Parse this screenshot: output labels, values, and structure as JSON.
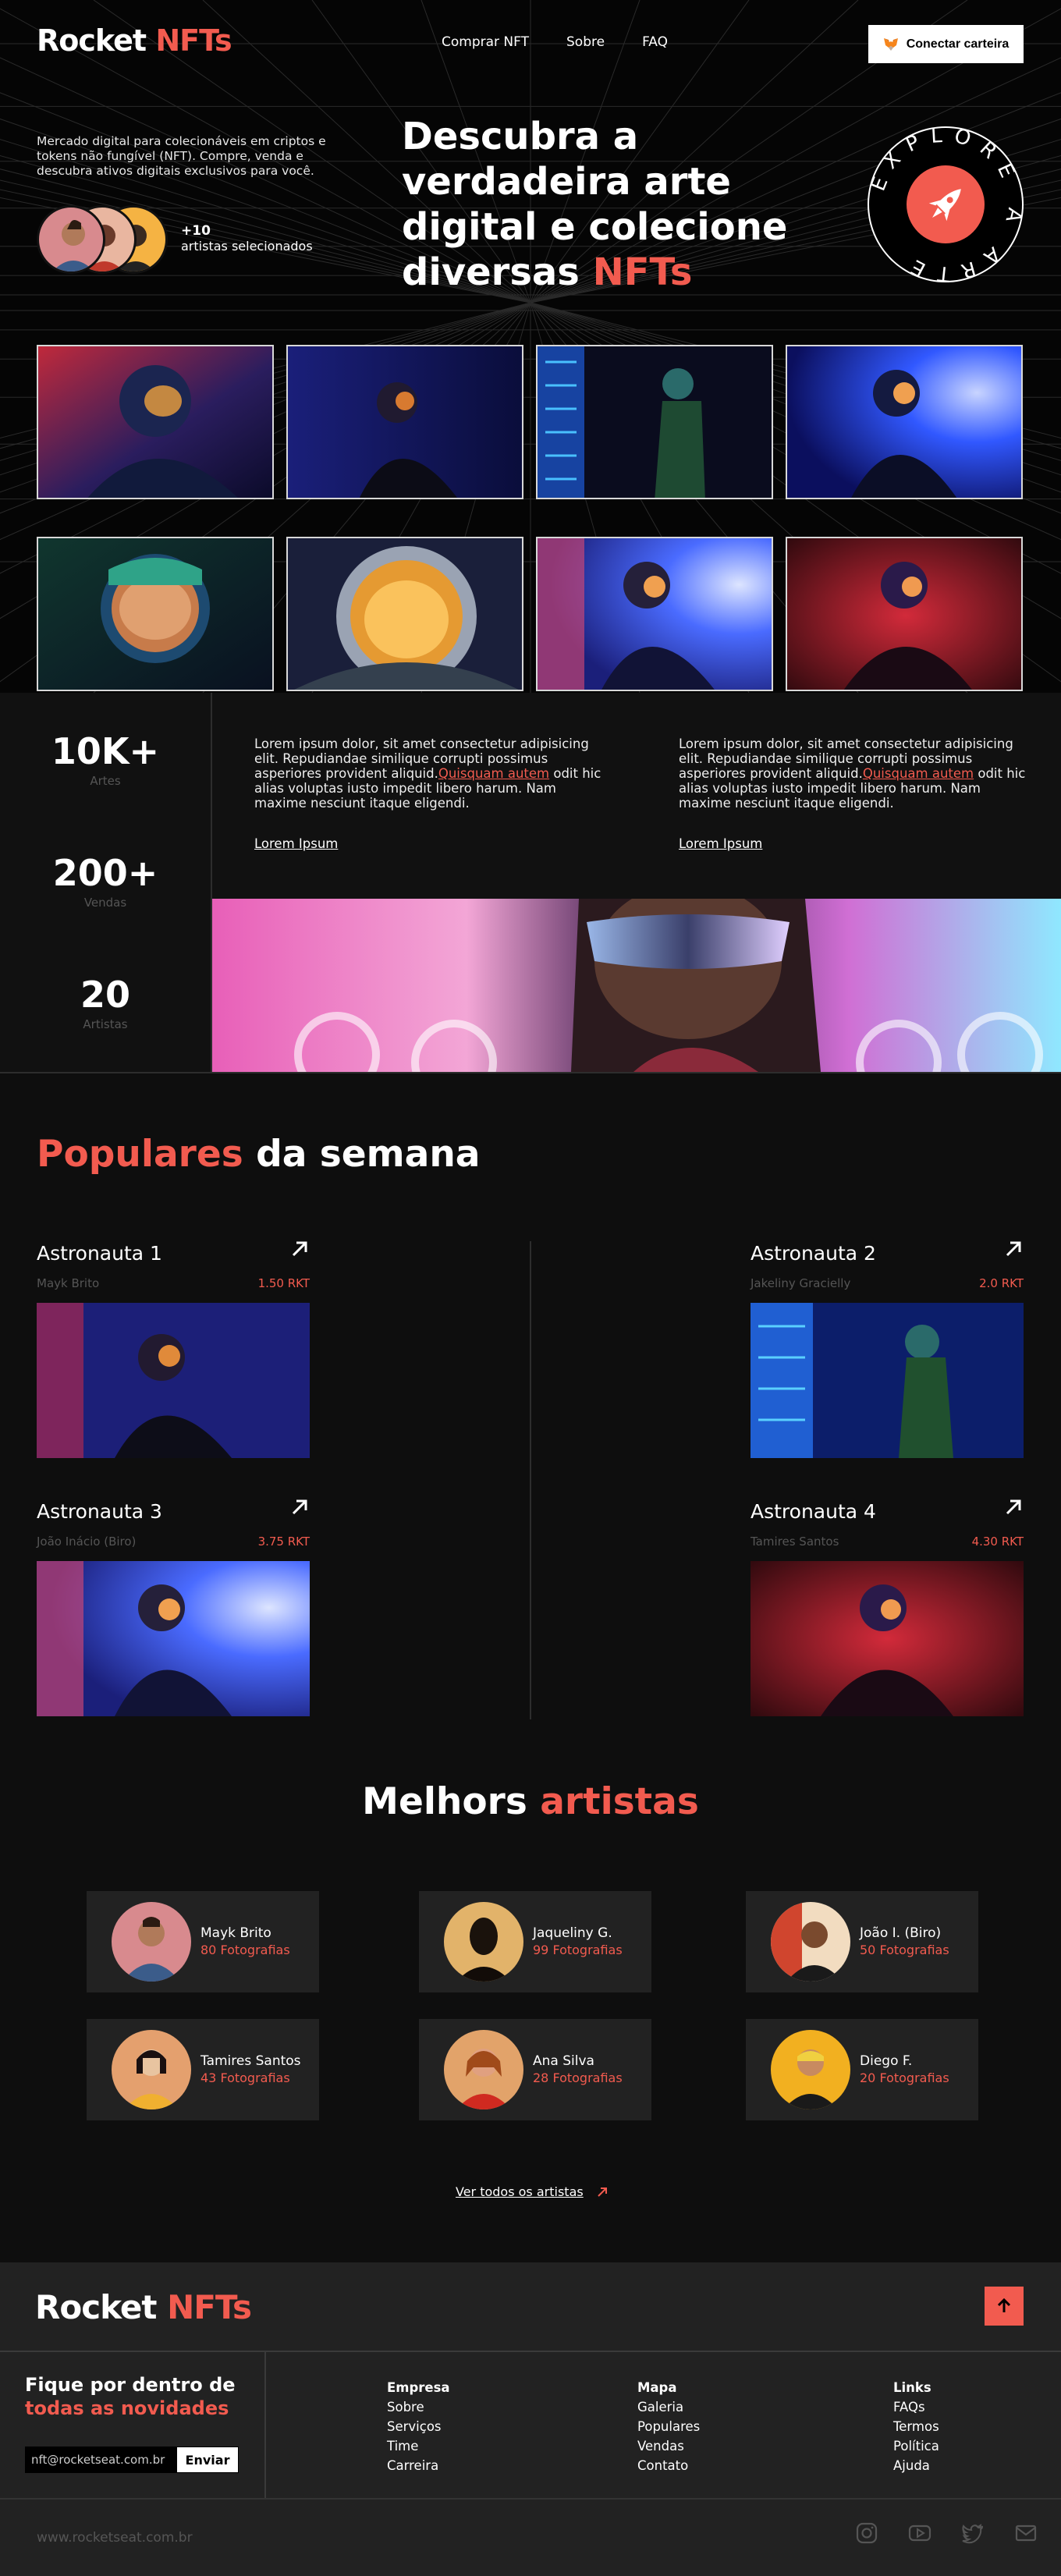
{
  "header": {
    "logo_main": "Rocket",
    "logo_accent": "NFTs",
    "nav": [
      "Comprar NFT",
      "Sobre",
      "FAQ"
    ],
    "wallet_button": "Conectar carteira"
  },
  "hero": {
    "description": "Mercado digital para colecionáveis em criptos e tokens não fungível (NFT). Compre, venda e descubra ativos digitais exclusivos para você.",
    "artists_count": "+10",
    "artists_label": "artistas selecionados",
    "headline_main": "Descubra a verdadeira arte digital e colecione diversas",
    "headline_accent": "NFTs",
    "badge_text": "EXPLORE A ARTE"
  },
  "stats": [
    {
      "number": "10K+",
      "label": "Artes"
    },
    {
      "number": "200+",
      "label": "Vendas"
    },
    {
      "number": "20",
      "label": "Artistas"
    }
  ],
  "info": {
    "text_before": "Lorem ipsum dolor, sit amet consectetur adipisicing elit. Repudiandae similique corrupti possimus asperiores provident aliquid.",
    "text_link": "Quisquam autem",
    "text_after": " odit hic alias voluptas iusto impedit libero harum. Nam maxime nesciunt itaque eligendi.",
    "link_label": "Lorem Ipsum"
  },
  "popular": {
    "title_accent": "Populares",
    "title_rest": "da semana",
    "items": [
      {
        "name": "Astronauta 1",
        "author": "Mayk Brito",
        "price": "1.50 RKT"
      },
      {
        "name": "Astronauta 2",
        "author": "Jakeliny Gracielly",
        "price": "2.0 RKT"
      },
      {
        "name": "Astronauta 3",
        "author": "João Inácio (Biro)",
        "price": "3.75 RKT"
      },
      {
        "name": "Astronauta 4",
        "author": "Tamires Santos",
        "price": "4.30 RKT"
      }
    ]
  },
  "artists": {
    "title_main": "Melhors",
    "title_accent": "artistas",
    "items": [
      {
        "name": "Mayk Brito",
        "photos": "80 Fotografias"
      },
      {
        "name": "Jaqueliny G.",
        "photos": "99 Fotografias"
      },
      {
        "name": "João I. (Biro)",
        "photos": "50 Fotografias"
      },
      {
        "name": "Tamires Santos",
        "photos": "43 Fotografias"
      },
      {
        "name": "Ana Silva",
        "photos": "28 Fotografias"
      },
      {
        "name": "Diego F.",
        "photos": "20 Fotografias"
      }
    ],
    "see_all": "Ver todos os artistas"
  },
  "footer": {
    "logo_main": "Rocket",
    "logo_accent": "NFTs",
    "news_line1": "Fique por dentro de",
    "news_line2": "todas as novidades",
    "email_value": "nft@rocketseat.com.br",
    "send_button": "Enviar",
    "columns": [
      {
        "title": "Empresa",
        "links": [
          "Sobre",
          "Serviços",
          "Time",
          "Carreira"
        ]
      },
      {
        "title": "Mapa",
        "links": [
          "Galeria",
          "Populares",
          "Vendas",
          "Contato"
        ]
      },
      {
        "title": "Links",
        "links": [
          "FAQs",
          "Termos",
          "Política",
          "Ajuda"
        ]
      }
    ],
    "url": "www.rocketseat.com.br",
    "social_icons": [
      "instagram-icon",
      "youtube-icon",
      "twitter-icon",
      "mail-icon"
    ]
  },
  "colors": {
    "accent": "#f25b4f",
    "background": "#0e0e0e",
    "card": "#222222"
  }
}
